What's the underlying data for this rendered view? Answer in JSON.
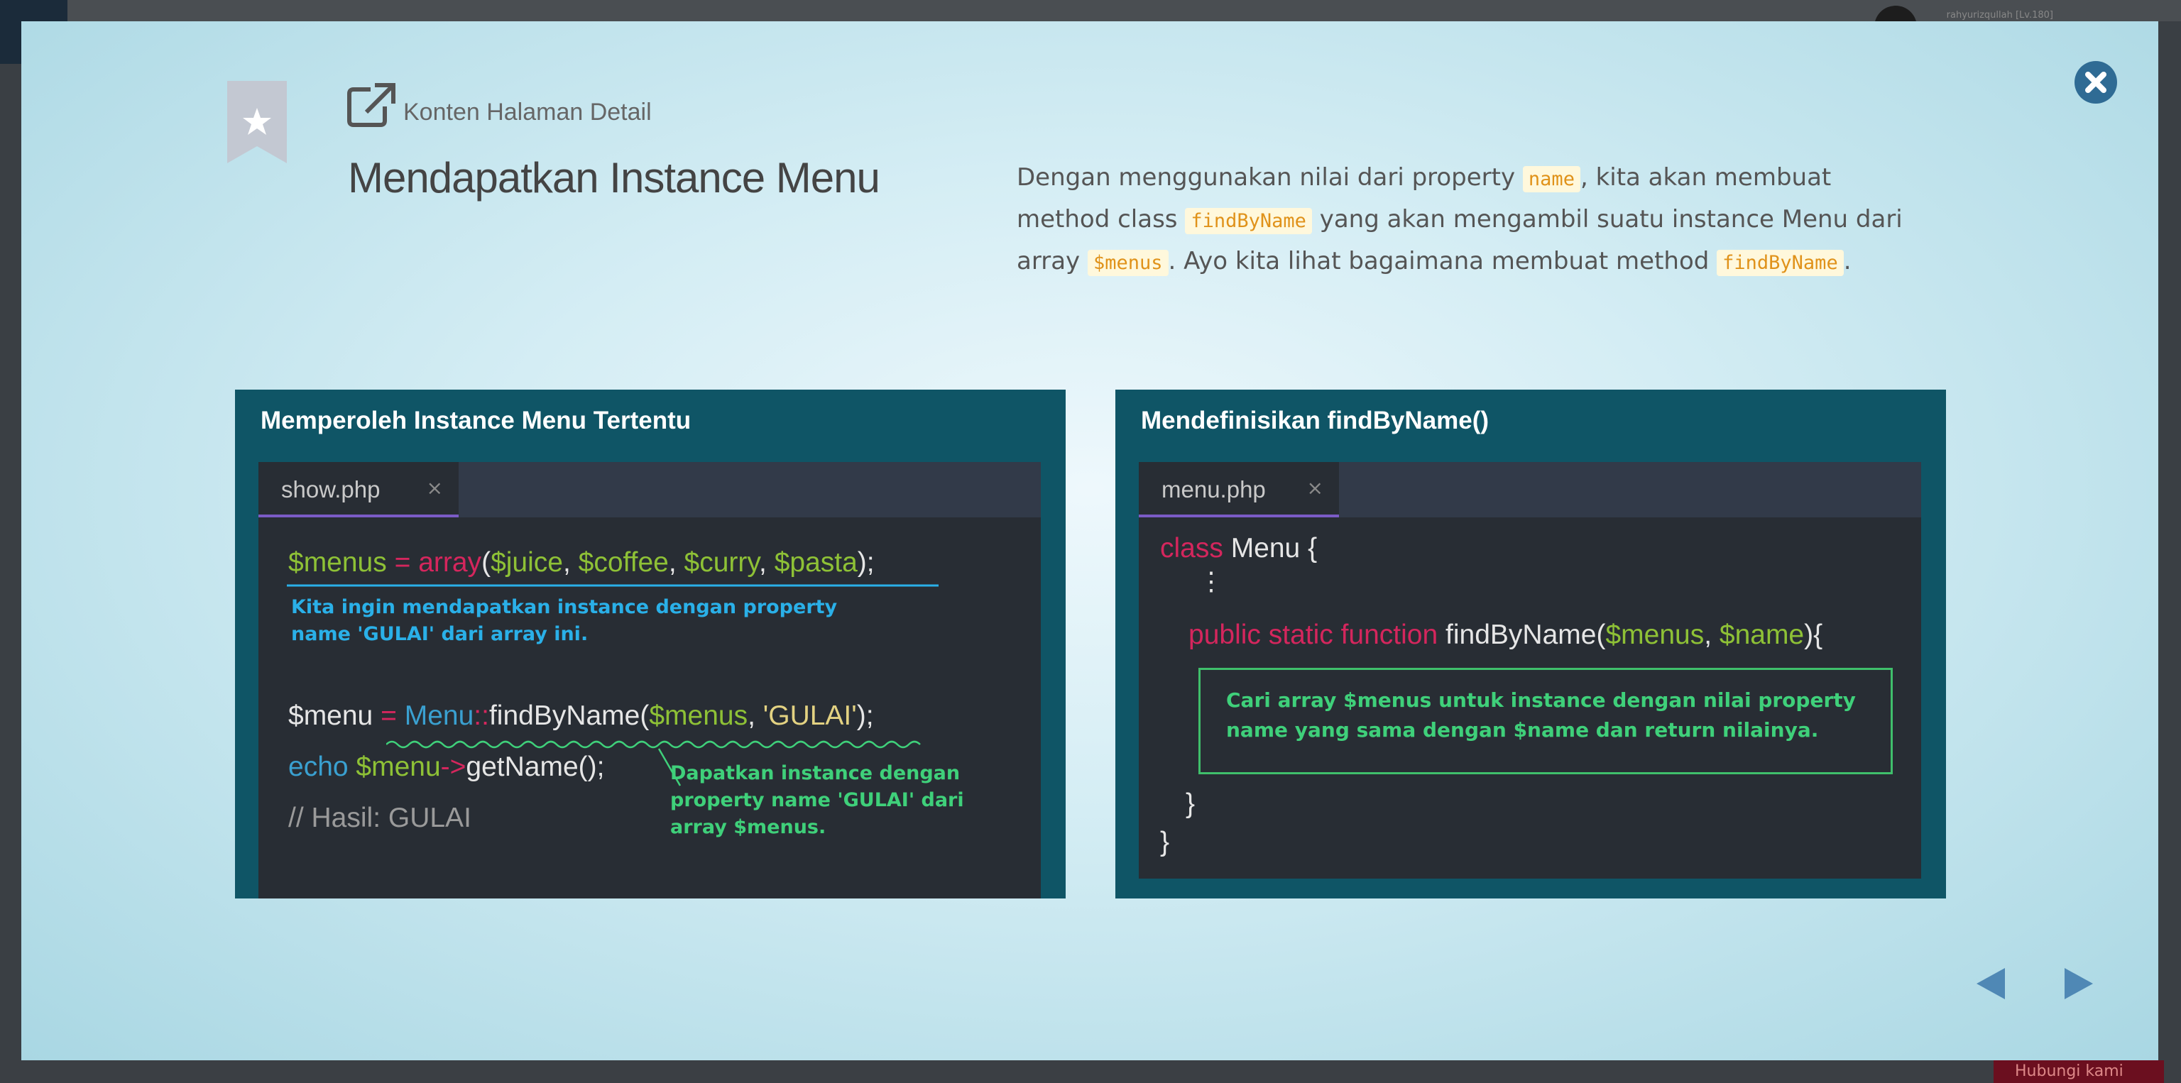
{
  "background": {
    "user_label": "rahyurizqullah [Lv.180]",
    "help_button_label": "Hubungi kami"
  },
  "modal": {
    "kicker_label": "Konten Halaman Detail",
    "title": "Mendapatkan Instance Menu",
    "description": {
      "t1": "Dengan menggunakan nilai dari property ",
      "c1": "name",
      "t2": ", kita akan membuat method class ",
      "c2": "findByName",
      "t3": " yang akan mengambil suatu instance Menu dari array ",
      "c3": "$menus",
      "t4": ". Ayo kita lihat bagaimana membuat method ",
      "c4": "findByName",
      "t5": "."
    }
  },
  "panel_left": {
    "title": "Memperoleh Instance Menu Tertentu",
    "tab": "show.php",
    "tab_close": "×",
    "line1": {
      "a": "$menus",
      "b": " = ",
      "c": "array",
      "d": "(",
      "e": "$juice",
      "f": ", ",
      "g": "$coffee",
      "h": ", ",
      "i": "$curry",
      "j": ", ",
      "k": "$pasta",
      "l": ");"
    },
    "note1": "Kita ingin mendapatkan instance dengan property name 'GULAI' dari array ini.",
    "line2": {
      "a": "$menu",
      "b": " = ",
      "c": "Menu",
      "d": "::",
      "e": "findByName(",
      "f": "$menus",
      "g": ", ",
      "h": "'GULAI'",
      "i": ");"
    },
    "line3": {
      "a": "echo ",
      "b": "$menu",
      "c": "->",
      "d": "getName();"
    },
    "line4": "// Hasil: GULAI",
    "note2": "Dapatkan instance dengan property name 'GULAI' dari array $menus."
  },
  "panel_right": {
    "title": "Mendefinisikan findByName()",
    "tab": "menu.php",
    "tab_close": "×",
    "line1": {
      "a": "class",
      "b": " Menu {"
    },
    "dots": "⋮",
    "line2": {
      "a": "public static function ",
      "b": "findByName(",
      "c": "$menus",
      "d": ", ",
      "e": "$name",
      "f": "){"
    },
    "note": "Cari array $menus untuk instance dengan nilai property name yang sama dengan $name dan return nilainya.",
    "line3": "}",
    "line4": "}"
  },
  "colors": {
    "panel_bg": "#0f5566",
    "editor_bg": "#282d34",
    "variable": "#8ec136",
    "keyword": "#d4265d",
    "class_name": "#3aa0d0",
    "string": "#e3d282",
    "note_blue": "#2ab0e8",
    "note_green": "#3fd07a",
    "close_button": "#2f6b94"
  }
}
